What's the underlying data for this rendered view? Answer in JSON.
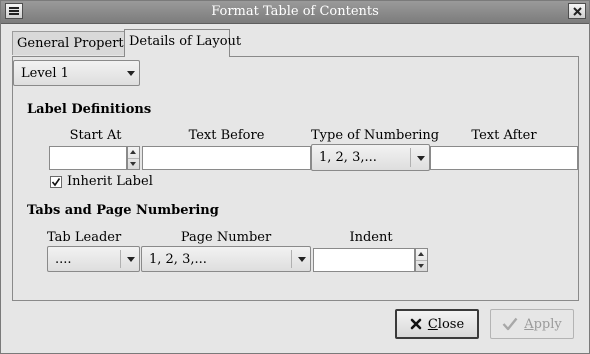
{
  "window": {
    "title": "Format Table of Contents"
  },
  "tabs": [
    {
      "label": "General Properties"
    },
    {
      "label": "Details of Layout"
    }
  ],
  "level_select": {
    "value": "Level 1"
  },
  "label_definitions": {
    "heading": "Label Definitions",
    "start_at_label": "Start At",
    "start_at_value": "",
    "text_before_label": "Text Before",
    "text_before_value": "",
    "numbering_label": "Type of Numbering",
    "numbering_value": "1, 2, 3,...",
    "text_after_label": "Text After",
    "text_after_value": "",
    "inherit_label": "Inherit Label",
    "inherit_checked": true
  },
  "tabs_numbering": {
    "heading": "Tabs and Page Numbering",
    "tab_leader_label": "Tab Leader",
    "tab_leader_value": "....",
    "page_number_label": "Page Number",
    "page_number_value": "1, 2, 3,...",
    "indent_label": "Indent",
    "indent_value": ""
  },
  "buttons": {
    "close": {
      "label_first": "C",
      "label_rest": "lose",
      "icon": "close-x-icon"
    },
    "apply": {
      "label_first": "A",
      "label_rest": "pply",
      "icon": "checkmark-icon"
    }
  }
}
